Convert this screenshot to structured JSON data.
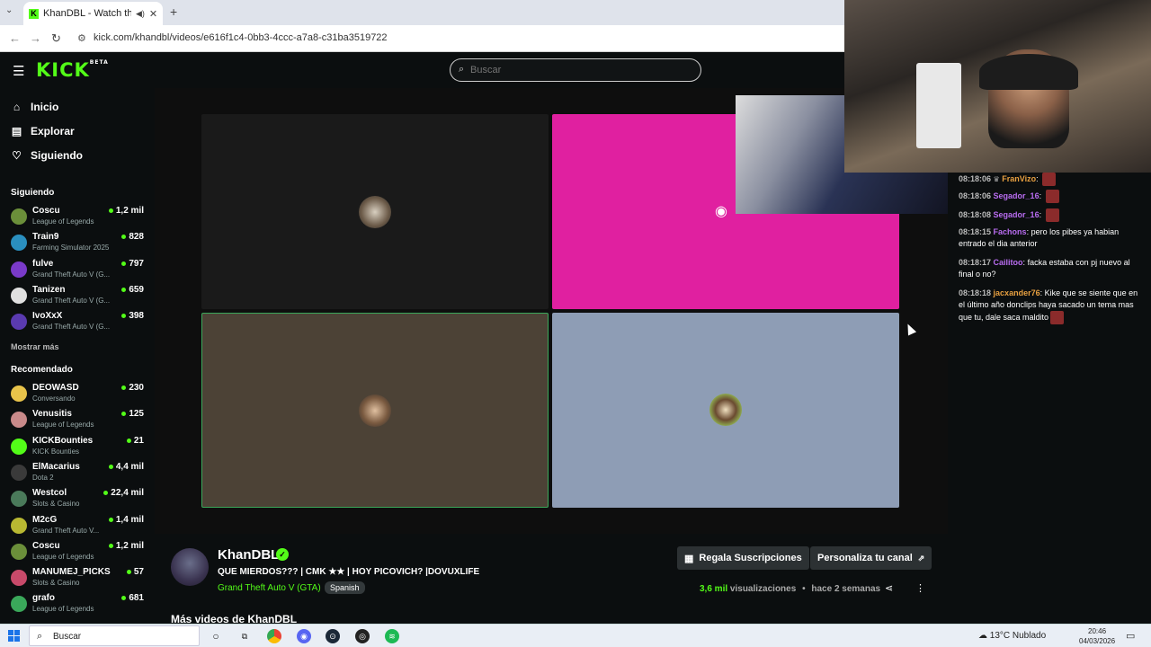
{
  "browser": {
    "tab_title": "KhanDBL - Watch the VOD",
    "tab_favicon": "K",
    "url": "kick.com/khandbl/videos/e616f1c4-0bb3-4ccc-a7a8-c31ba3519722"
  },
  "topnav": {
    "logo": "KICK",
    "logo_badge": "BETA",
    "search_placeholder": "Buscar"
  },
  "sidebar": {
    "nav": [
      {
        "label": "Inicio",
        "icon": "home-icon"
      },
      {
        "label": "Explorar",
        "icon": "compass-icon"
      },
      {
        "label": "Siguiendo",
        "icon": "heart-icon"
      }
    ],
    "following_header": "Siguiendo",
    "following": [
      {
        "name": "Coscu",
        "game": "League of Legends",
        "viewers": "1,2 mil",
        "color": "#6b8f3a"
      },
      {
        "name": "Train9",
        "game": "Farming Simulator 2025",
        "viewers": "828",
        "color": "#2a8fbf"
      },
      {
        "name": "fulve",
        "game": "Grand Theft Auto V (G...",
        "viewers": "797",
        "color": "#7a3ac9"
      },
      {
        "name": "Tanizen",
        "game": "Grand Theft Auto V (G...",
        "viewers": "659",
        "color": "#e0e0e0"
      },
      {
        "name": "IvoXxX",
        "game": "Grand Theft Auto V (G...",
        "viewers": "398",
        "color": "#5a3ab0"
      }
    ],
    "show_more": "Mostrar más",
    "recommended_header": "Recomendado",
    "recommended": [
      {
        "name": "DEOWASD",
        "game": "Conversando",
        "viewers": "230",
        "color": "#e8c34a"
      },
      {
        "name": "Venusitis",
        "game": "League of Legends",
        "viewers": "125",
        "color": "#c98a8a"
      },
      {
        "name": "KICKBounties",
        "game": "KICK Bounties",
        "viewers": "21",
        "color": "#53fc18"
      },
      {
        "name": "ElMacarius",
        "game": "Dota 2",
        "viewers": "4,4 mil",
        "color": "#3a3a3a"
      },
      {
        "name": "Westcol",
        "game": "Slots & Casino",
        "viewers": "22,4 mil",
        "color": "#4a7a5a"
      },
      {
        "name": "M2cG",
        "game": "Grand Theft Auto V...",
        "viewers": "1,4 mil",
        "color": "#b8b832"
      },
      {
        "name": "Coscu",
        "game": "League of Legends",
        "viewers": "1,2 mil",
        "color": "#6b8f3a"
      },
      {
        "name": "MANUMEJ_PICKS",
        "game": "Slots & Casino",
        "viewers": "57",
        "color": "#c84a6a"
      },
      {
        "name": "grafo",
        "game": "League of Legends",
        "viewers": "681",
        "color": "#3aa85a"
      }
    ]
  },
  "player": {
    "tiles": [
      {
        "color": "#1a1a1a"
      },
      {
        "color": "#e020a0"
      },
      {
        "color": "#4c4236"
      },
      {
        "color": "#8e9db5"
      }
    ],
    "discord_icon": "discord-icon"
  },
  "chat": {
    "messages": [
      {
        "time": "08:18:06",
        "user": "FranVizo",
        "color": "#e8a040",
        "text": "",
        "emote": true,
        "badge": true
      },
      {
        "time": "08:18:06",
        "user": "Segador_16",
        "color": "#b86cf0",
        "text": "",
        "emote": true
      },
      {
        "time": "08:18:08",
        "user": "Segador_16",
        "color": "#b86cf0",
        "text": "",
        "emote": true
      },
      {
        "time": "08:18:15",
        "user": "Fachons",
        "color": "#b86cf0",
        "text": "pero los pibes ya habian entrado el dia anterior"
      },
      {
        "time": "08:18:17",
        "user": "Cailitoo",
        "color": "#b86cf0",
        "text": "facka estaba con pj nuevo al final o no?"
      },
      {
        "time": "08:18:18",
        "user": "jacxander76",
        "color": "#e8a040",
        "text": "Kike que se siente que en el último año donclips haya sacado un tema mas que tu, dale saca maldito",
        "emote": true
      }
    ]
  },
  "channel": {
    "name": "KhanDBL",
    "title": "QUE MIERDOS??? | CMK ★★ | HOY PICOVICH? |DOVUXLIFE",
    "category": "Grand Theft Auto V (GTA)",
    "language": "Spanish",
    "gift_button": "Regala Suscripciones",
    "customize_button": "Personaliza tu canal",
    "views_number": "3,6 mil",
    "views_label": "visualizaciones",
    "separator": "•",
    "ago": "hace 2 semanas",
    "more_videos": "Más videos de KhanDBL"
  },
  "taskbar": {
    "search": "Buscar",
    "weather": "13°C  Nublado",
    "time": "20:46",
    "date": "04/03/2026"
  }
}
